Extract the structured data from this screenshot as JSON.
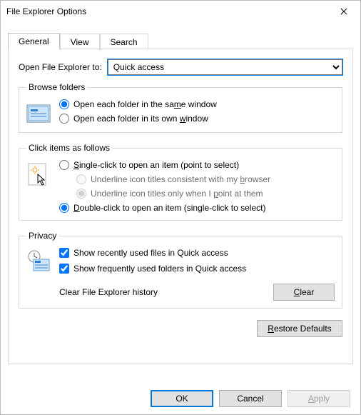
{
  "window": {
    "title": "File Explorer Options"
  },
  "tabs": {
    "general": "General",
    "view": "View",
    "search": "Search"
  },
  "open_to": {
    "label": "Open File Explorer to:",
    "selected": "Quick access",
    "options": [
      "Quick access"
    ]
  },
  "browse": {
    "legend": "Browse folders",
    "same_pre": "Open each folder in the sa",
    "same_key": "m",
    "same_post": "e window",
    "own_pre": "Open each folder in its own ",
    "own_key": "w",
    "own_post": "indow"
  },
  "click": {
    "legend": "Click items as follows",
    "single_key": "S",
    "single_post": "ingle-click to open an item (point to select)",
    "browser_pre": "Underline icon titles consistent with my ",
    "browser_key": "b",
    "browser_post": "rowser",
    "point_pre": "Underline icon titles only when I ",
    "point_key": "p",
    "point_post": "oint at them",
    "double_key": "D",
    "double_post": "ouble-click to open an item (single-click to select)"
  },
  "privacy": {
    "legend": "Privacy",
    "recent": "Show recently used files in Quick access",
    "frequent": "Show frequently used folders in Quick access",
    "clear_label": "Clear File Explorer history",
    "clear_btn_key": "C",
    "clear_btn_post": "lear"
  },
  "restore": {
    "key": "R",
    "post": "estore Defaults"
  },
  "footer": {
    "ok": "OK",
    "cancel": "Cancel",
    "apply_key": "A",
    "apply_post": "pply"
  }
}
